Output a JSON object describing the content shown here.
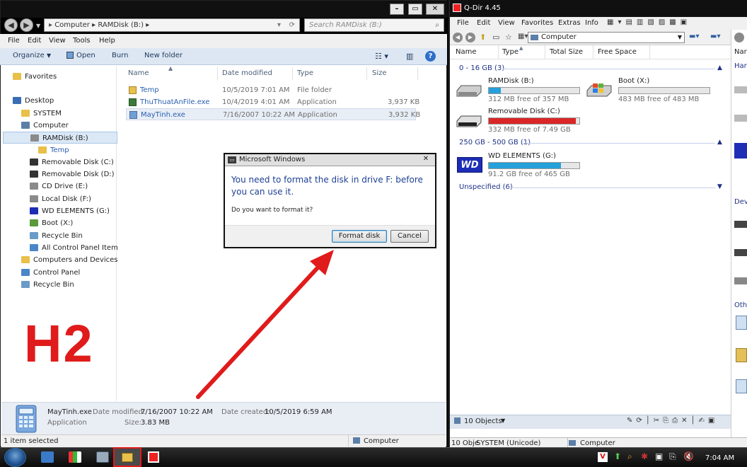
{
  "explorer": {
    "address": [
      "Computer",
      "RAMDisk (B:)"
    ],
    "search_placeholder": "Search RAMDisk (B:)",
    "menu": [
      "File",
      "Edit",
      "View",
      "Tools",
      "Help"
    ],
    "toolbar": {
      "organize": "Organize",
      "open": "Open",
      "burn": "Burn",
      "new_folder": "New folder"
    },
    "nav": [
      {
        "label": "Favorites",
        "indent": 0,
        "icon": "star-folder-icon",
        "color": "#e8c04a"
      },
      {
        "label": "Desktop",
        "indent": 0,
        "icon": "desktop-icon",
        "color": "#3a6db5"
      },
      {
        "label": "SYSTEM",
        "indent": 1,
        "icon": "user-folder-icon",
        "color": "#e8c04a"
      },
      {
        "label": "Computer",
        "indent": 1,
        "icon": "computer-icon",
        "color": "#5c7fa8"
      },
      {
        "label": "RAMDisk (B:)",
        "indent": 2,
        "icon": "drive-icon",
        "color": "#8a8a8a",
        "selected": true
      },
      {
        "label": "Temp",
        "indent": 3,
        "icon": "folder-icon",
        "color": "#e8c04a",
        "link": true
      },
      {
        "label": "Removable Disk (C:)",
        "indent": 2,
        "icon": "removable-drive-icon",
        "color": "#333"
      },
      {
        "label": "Removable Disk (D:)",
        "indent": 2,
        "icon": "removable-drive-icon",
        "color": "#333"
      },
      {
        "label": "CD Drive (E:)",
        "indent": 2,
        "icon": "cd-drive-icon",
        "color": "#8a8a8a"
      },
      {
        "label": "Local Disk (F:)",
        "indent": 2,
        "icon": "drive-icon",
        "color": "#8a8a8a"
      },
      {
        "label": "WD ELEMENTS (G:)",
        "indent": 2,
        "icon": "wd-drive-icon",
        "color": "#1d2db5"
      },
      {
        "label": "Boot (X:)",
        "indent": 2,
        "icon": "windows-drive-icon",
        "color": "#5a9a3a"
      },
      {
        "label": "Recycle Bin",
        "indent": 2,
        "icon": "recycle-bin-icon",
        "color": "#6a9ac8"
      },
      {
        "label": "All Control Panel Items",
        "indent": 2,
        "icon": "control-panel-icon",
        "color": "#4a86c8"
      },
      {
        "label": "Computers and Devices",
        "indent": 1,
        "icon": "folder-icon",
        "color": "#e8c04a"
      },
      {
        "label": "Control Panel",
        "indent": 1,
        "icon": "control-panel-icon",
        "color": "#4a86c8"
      },
      {
        "label": "Recycle Bin",
        "indent": 1,
        "icon": "recycle-bin-icon",
        "color": "#6a9ac8"
      }
    ],
    "columns": [
      "Name",
      "Date modified",
      "Type",
      "Size"
    ],
    "files": [
      {
        "name": "Temp",
        "date": "10/5/2019 7:01 AM",
        "type": "File folder",
        "size": "",
        "icon": "folder-icon",
        "color": "#e8c04a"
      },
      {
        "name": "ThuThuatAnFile.exe",
        "date": "10/4/2019 4:01 AM",
        "type": "Application",
        "size": "3,937 KB",
        "icon": "exe-icon",
        "color": "#3a7a3a"
      },
      {
        "name": "MayTinh.exe",
        "date": "7/16/2007 10:22 AM",
        "type": "Application",
        "size": "3,932 KB",
        "icon": "calculator-icon",
        "color": "#6f9fd8",
        "selected": true
      }
    ],
    "details": {
      "name": "MayTinh.exe",
      "type": "Application",
      "date_modified_label": "Date modified:",
      "date_modified": "7/16/2007 10:22 AM",
      "size_label": "Size:",
      "size": "3.83 MB",
      "date_created_label": "Date created:",
      "date_created": "10/5/2019 6:59 AM"
    },
    "status_left": "1 item selected",
    "status_right": "Computer"
  },
  "overlay": {
    "text": "H2",
    "color": "#e01b1b"
  },
  "dialog": {
    "title": "Microsoft Windows",
    "message": "You need to format the disk in drive F: before you can use it.",
    "question": "Do you want to format it?",
    "format_button": "Format disk",
    "cancel_button": "Cancel"
  },
  "qdir": {
    "title": "Q-Dir 4.45",
    "menu": [
      "File",
      "Edit",
      "View",
      "Favorites",
      "Extras",
      "Info"
    ],
    "address": "Computer",
    "columns": [
      "Name",
      "Type",
      "Total Size",
      "Free Space"
    ],
    "groups": [
      {
        "label": "0 - 16 GB (3)",
        "drives": [
          {
            "name": "RAMDisk (B:)",
            "free": "312 MB free of 357 MB",
            "fill": 0.13,
            "color": "#26a0da",
            "icon": "hard-drive-icon"
          },
          {
            "name": "Boot (X:)",
            "free": "483 MB free of 483 MB",
            "fill": 0.0,
            "color": "#26a0da",
            "icon": "windows-drive-icon"
          },
          {
            "name": "Removable Disk (C:)",
            "free": "332 MB free of 7.49 GB",
            "fill": 0.96,
            "color": "#da2626",
            "icon": "removable-drive-icon"
          }
        ]
      },
      {
        "label": "250 GB - 500 GB (1)",
        "drives": [
          {
            "name": "WD ELEMENTS (G:)",
            "free": "91.2 GB free of 465 GB",
            "fill": 0.8,
            "color": "#26a0da",
            "icon": "wd-drive-icon"
          }
        ]
      },
      {
        "label": "Unspecified (6)",
        "drives": []
      }
    ],
    "side_labels": [
      "Har",
      "Dev",
      "Oth"
    ],
    "objects": "10 Objects",
    "status_left": "10 Obje",
    "status_mid": "SYSTEM (Unicode)",
    "status_right": "Computer"
  },
  "taskbar": {
    "time": "7:04 AM",
    "pinned": [
      {
        "icon": "start-orb-icon"
      },
      {
        "icon": "explorer-icon"
      },
      {
        "icon": "app-icon"
      },
      {
        "icon": "app2-icon"
      },
      {
        "icon": "explorer-active-icon"
      },
      {
        "icon": "qdir-icon"
      }
    ]
  }
}
